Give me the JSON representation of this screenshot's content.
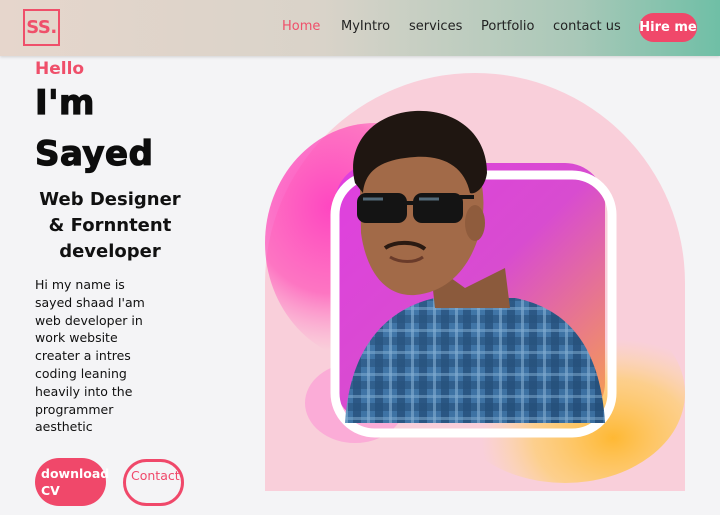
{
  "logo": {
    "text": "SS."
  },
  "nav": {
    "items": [
      {
        "label": "Home",
        "active": true
      },
      {
        "label": "MyIntro",
        "active": false
      },
      {
        "label": "services",
        "active": false
      },
      {
        "label": "Portfolio",
        "active": false
      },
      {
        "label": "contact us",
        "active": false
      }
    ],
    "hire_label": "Hire me"
  },
  "hero": {
    "greeting": "Hello",
    "intro": "I'm",
    "name": "Sayed",
    "role": "Web Designer & Fornntent developer",
    "bio": "Hi my name is sayed shaad I'am web developer in work website creater a intres coding leaning heavily into the programmer aesthetic",
    "download_label": "download CV",
    "contact_label": "Contact Me"
  },
  "colors": {
    "accent": "#f0486a",
    "arch": "#f9cfda"
  }
}
